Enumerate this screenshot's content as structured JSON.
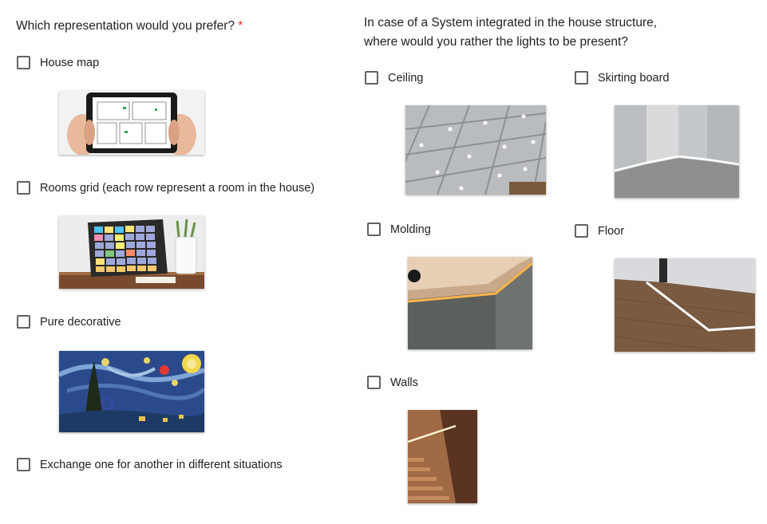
{
  "left_question": {
    "title": "Which representation would you prefer?",
    "required_mark": "*",
    "options": [
      {
        "label": "House map",
        "image": "tablet-house-map-image"
      },
      {
        "label": "Rooms grid (each row represent a room in the house)",
        "image": "rooms-grid-panel-image"
      },
      {
        "label": "Pure decorative",
        "image": "starry-night-painting-image"
      },
      {
        "label": "Exchange one for another in different situations"
      }
    ]
  },
  "right_question": {
    "title_line1": "In case of a System integrated in the house structure,",
    "title_line2": "where would you rather the lights to be present?",
    "options": [
      {
        "label": "Ceiling",
        "image": "ceiling-lights-image"
      },
      {
        "label": "Skirting board",
        "image": "skirting-board-lights-image"
      },
      {
        "label": "Molding",
        "image": "molding-lights-image"
      },
      {
        "label": "Floor",
        "image": "floor-lights-image"
      },
      {
        "label": "Walls",
        "image": "wall-stair-lights-image"
      }
    ]
  },
  "colors": {
    "required": "#d93025",
    "checkbox_border": "#5f6368",
    "text": "#202124"
  }
}
